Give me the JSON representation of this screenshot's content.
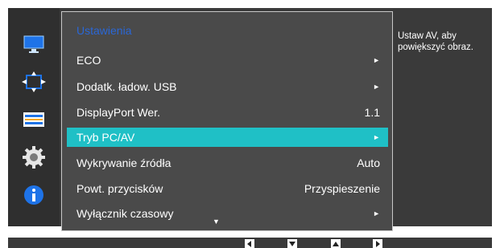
{
  "menu": {
    "title": "Ustawienia",
    "items": [
      {
        "label": "ECO",
        "value": "",
        "arrow": "►"
      },
      {
        "label": "Dodatk. ładow. USB",
        "value": "",
        "arrow": "►"
      },
      {
        "label": "DisplayPort Wer.",
        "value": "1.1",
        "arrow": ""
      },
      {
        "label": "Tryb PC/AV",
        "value": "",
        "arrow": "►"
      },
      {
        "label": "Wykrywanie źródła",
        "value": "Auto",
        "arrow": ""
      },
      {
        "label": "Powt. przycisków",
        "value": "Przyspieszenie",
        "arrow": ""
      },
      {
        "label": "Wyłącznik czasowy",
        "value": "",
        "arrow": "►"
      }
    ],
    "selected_index": 3,
    "scroll_indicator": "▼"
  },
  "help_text": "Ustaw AV, aby powiększyć obraz.",
  "sidebar_icons": [
    "monitor-icon",
    "resize-icon",
    "settings-panel-icon",
    "gear-icon",
    "info-icon"
  ],
  "colors": {
    "title": "#2a67d6",
    "selected_row": "#1fc0c6",
    "sidebar_blue": "#1e73e8"
  },
  "nav_buttons": [
    "left-icon",
    "down-icon",
    "up-icon",
    "right-icon"
  ]
}
